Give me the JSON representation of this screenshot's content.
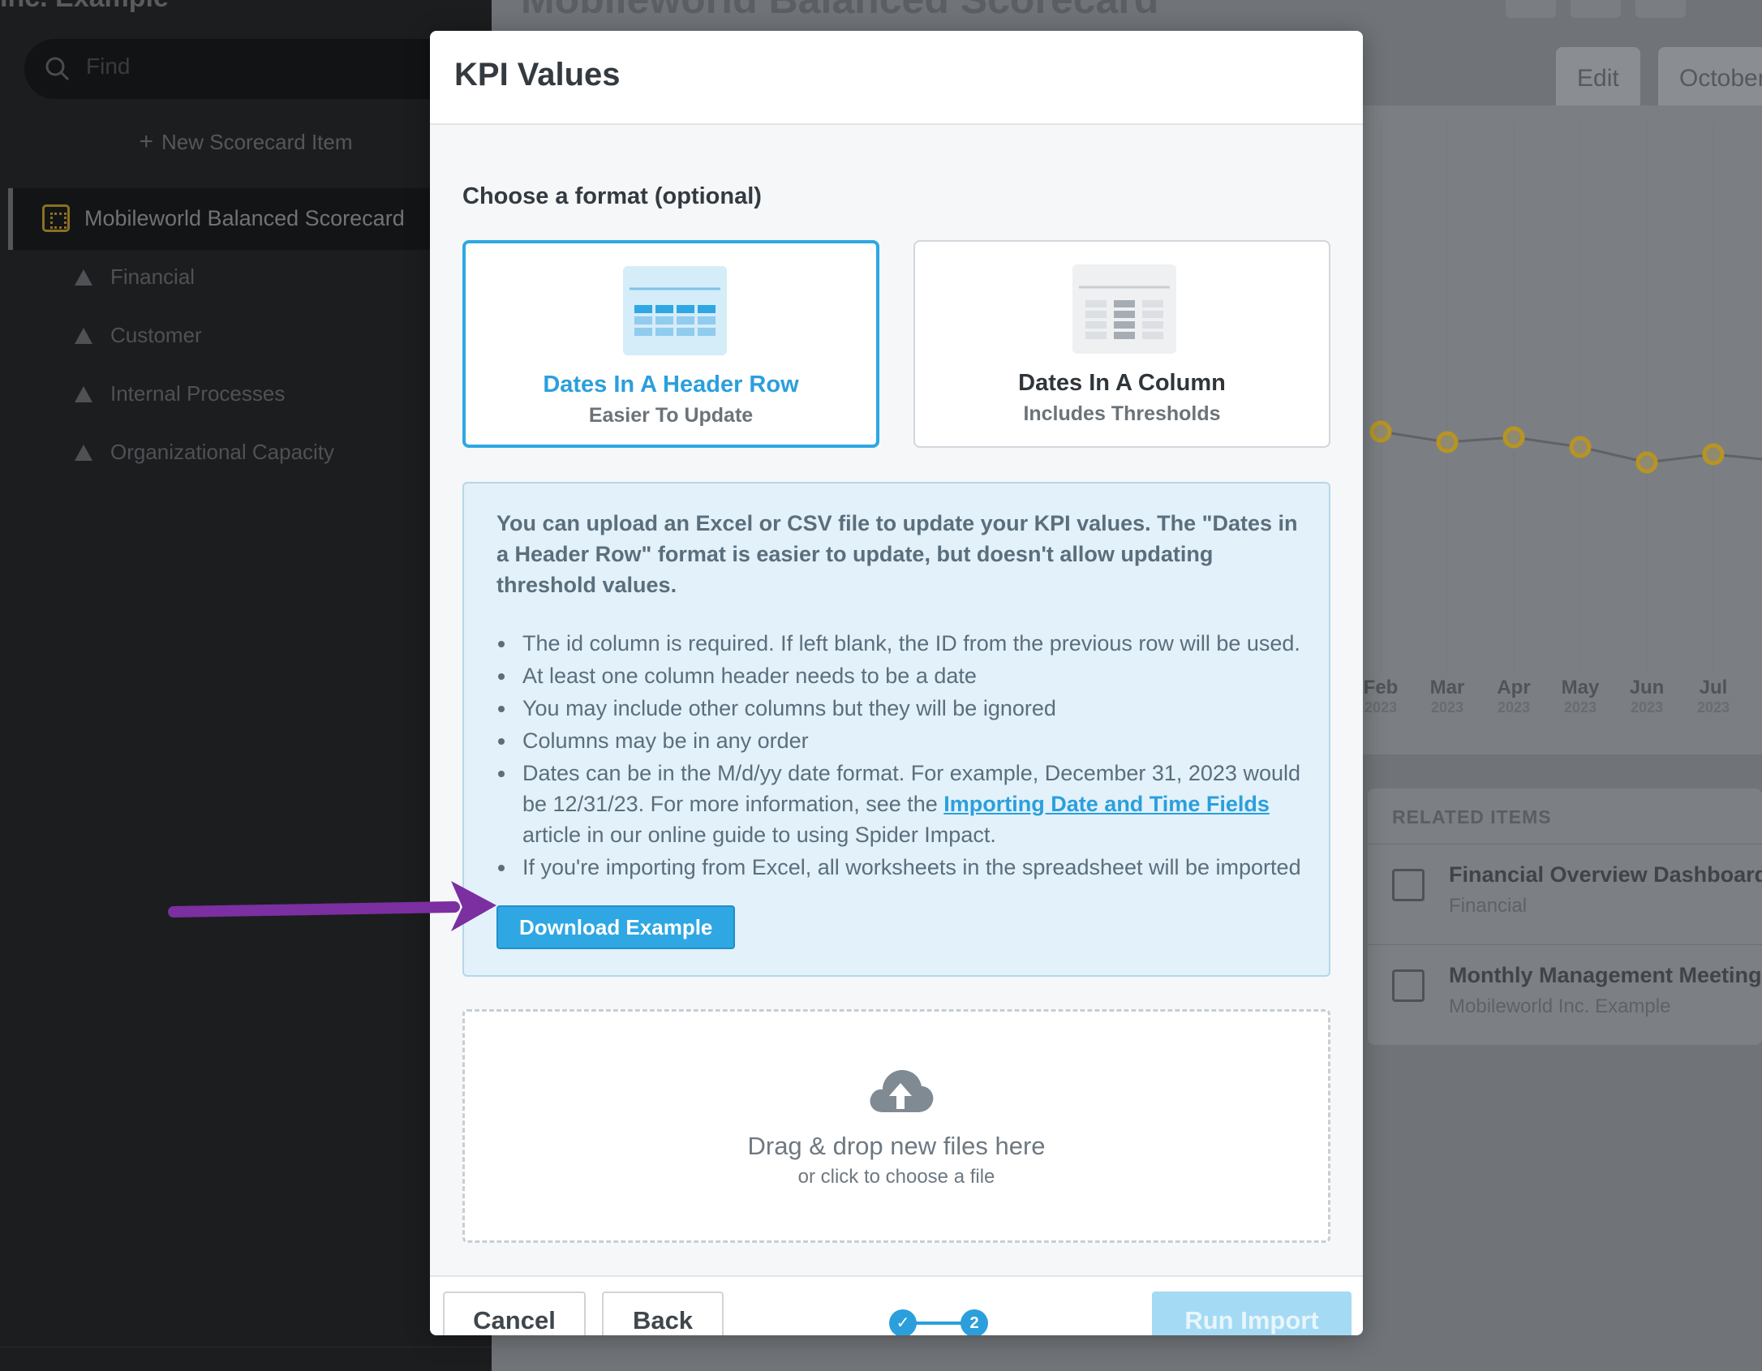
{
  "background": {
    "breadcrumb": "Inc. Example",
    "search_placeholder": "Find",
    "new_item_label": "New Scorecard Item",
    "active_item": "Mobileworld Balanced Scorecard",
    "nav_items": [
      {
        "label": "Financial"
      },
      {
        "label": "Customer"
      },
      {
        "label": "Internal Processes"
      },
      {
        "label": "Organizational Capacity"
      }
    ],
    "page_title": "Mobileworld Balanced Scorecard",
    "tabs": [
      {
        "label": "Edit"
      },
      {
        "label": "October"
      }
    ],
    "chart_months": [
      {
        "m": "Feb",
        "y": "2023"
      },
      {
        "m": "Mar",
        "y": "2023"
      },
      {
        "m": "Apr",
        "y": "2023"
      },
      {
        "m": "May",
        "y": "2023"
      },
      {
        "m": "Jun",
        "y": "2023"
      },
      {
        "m": "Jul",
        "y": "2023"
      }
    ],
    "related": {
      "header": "RELATED ITEMS",
      "items": [
        {
          "title": "Financial Overview Dashboard",
          "subtitle": "Financial"
        },
        {
          "title": "Monthly Management Meeting",
          "subtitle": "Mobileworld Inc. Example"
        }
      ]
    }
  },
  "modal": {
    "title": "KPI Values",
    "format_label": "Choose a format (optional)",
    "formats": [
      {
        "title": "Dates In A Header Row",
        "subtitle": "Easier To Update",
        "selected": true
      },
      {
        "title": "Dates In A Column",
        "subtitle": "Includes Thresholds",
        "selected": false
      }
    ],
    "info_text": "You can upload an Excel or CSV file to update your KPI values. The \"Dates in a Header Row\" format is easier to update, but doesn't allow updating threshold values.",
    "bullets": [
      "The id column is required. If left blank, the ID from the previous row will be used.",
      "At least one column header needs to be a date",
      "You may include other columns but they will be ignored",
      "Columns may be in any order"
    ],
    "date_bullet": {
      "before": "Dates can be in the M/d/yy date format. For example, December 31, 2023 would be 12/31/23. For more information, see the ",
      "link": "Importing Date and Time Fields",
      "after": " article in our online guide to using Spider Impact."
    },
    "last_bullet": "If you're importing from Excel, all worksheets in the spreadsheet will be imported",
    "download_label": "Download Example",
    "drop_title": "Drag & drop new files here",
    "drop_sub": "or click to choose a file",
    "footer": {
      "cancel": "Cancel",
      "back": "Back",
      "step2": "2",
      "run": "Run Import"
    }
  },
  "colors": {
    "accent": "#2fa7e3",
    "arrow": "#7b2fa0",
    "chart_line": "#d9a520"
  }
}
